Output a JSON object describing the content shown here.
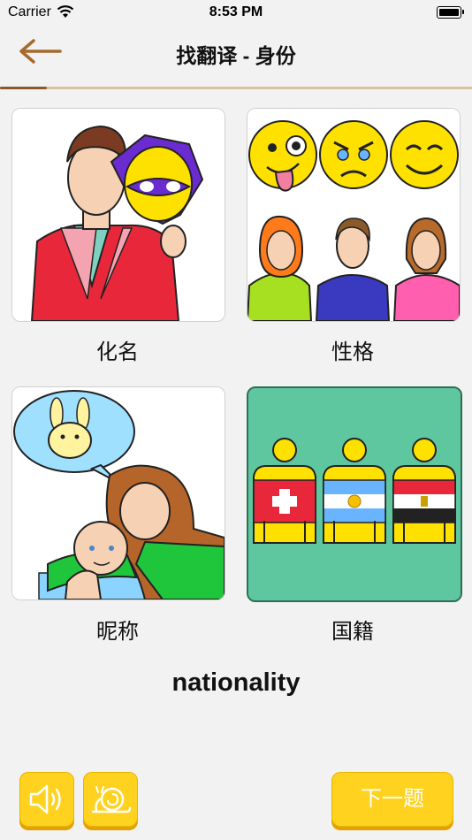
{
  "status_bar": {
    "carrier": "Carrier",
    "time": "8:53 PM"
  },
  "header": {
    "title": "找翻译 - 身份",
    "back_icon": "arrow-left-icon"
  },
  "progress": {
    "fraction": 0.1
  },
  "options": [
    {
      "label": "化名",
      "illustration": "man-holding-mask"
    },
    {
      "label": "性格",
      "illustration": "emoji-faces-and-people"
    },
    {
      "label": "昵称",
      "illustration": "mother-and-baby"
    },
    {
      "label": "国籍",
      "illustration": "flag-shirts",
      "selected": true
    }
  ],
  "prompt_word": "nationality",
  "controls": {
    "sound_icon": "speaker-icon",
    "slow_icon": "snail-icon",
    "next_label": "下一题"
  },
  "colors": {
    "accent_yellow": "#ffd21f",
    "selected_green": "#5fc7a0",
    "progress_brown": "#8a5a2b"
  }
}
